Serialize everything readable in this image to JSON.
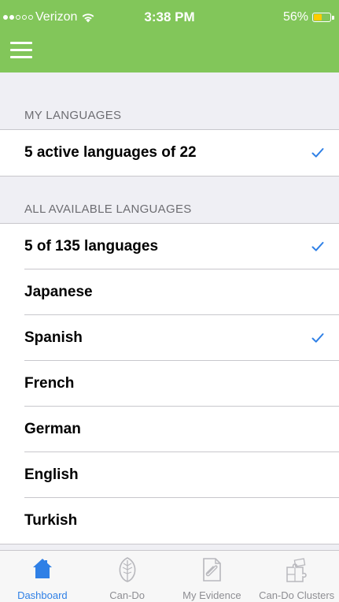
{
  "status_bar": {
    "carrier": "Verizon",
    "time": "3:38 PM",
    "battery_percent": "56%",
    "battery_level": 0.56,
    "signal_bars_filled": 2,
    "signal_bars_total": 5
  },
  "colors": {
    "header": "#82c65a",
    "accent": "#2f80e6",
    "battery": "#ffcc00"
  },
  "my_languages": {
    "section_title": "MY LANGUAGES",
    "summary": "5 active languages of 22",
    "summary_checked": true
  },
  "all_languages": {
    "section_title": "ALL AVAILABLE LANGUAGES",
    "summary": "5 of 135 languages",
    "summary_checked": true,
    "items": [
      {
        "label": "Japanese",
        "checked": false
      },
      {
        "label": "Spanish",
        "checked": true
      },
      {
        "label": "French",
        "checked": false
      },
      {
        "label": "German",
        "checked": false
      },
      {
        "label": "English",
        "checked": false
      },
      {
        "label": "Turkish",
        "checked": false
      }
    ]
  },
  "tabbar": {
    "items": [
      {
        "label": "Dashboard",
        "icon": "home-icon",
        "active": true
      },
      {
        "label": "Can-Do",
        "icon": "leaf-icon",
        "active": false
      },
      {
        "label": "My Evidence",
        "icon": "evidence-icon",
        "active": false
      },
      {
        "label": "Can-Do Clusters",
        "icon": "puzzle-icon",
        "active": false
      }
    ]
  }
}
